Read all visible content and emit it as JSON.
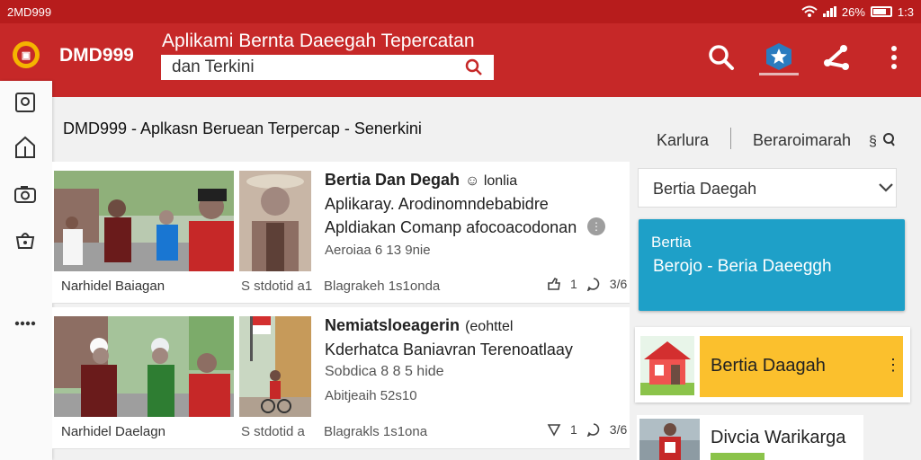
{
  "status": {
    "left": "2MD999",
    "battery": "26%",
    "time": "1:3"
  },
  "appbar": {
    "brand": "DMD999",
    "headline": "Aplikami Bernta Daeegah Tepercatan",
    "search_value": "dan Terkini",
    "actions": [
      "search-icon",
      "star-icon",
      "share-icon",
      "more-vert-icon"
    ]
  },
  "sidenav": {
    "items": [
      "profile-icon",
      "home-icon",
      "camera-icon",
      "basket-icon",
      "more-horiz-icon"
    ]
  },
  "page_title": "DMD999 - Aplkasn Beruean Terpercap - Senerkini",
  "feed": [
    {
      "title": "Bertia Dan Degah",
      "title_sub": "☺ lonlia",
      "desc1": "Aplikaray. Arodinomndebabidre",
      "desc2": "Apldiakan Comanp afocoacodonan",
      "meta": "Aeroiaa 6 13 9nie",
      "foot_left": "Narhidel Baiagan",
      "foot_mid": "S stdotid a1",
      "foot_right": "Blagrakeh 1s1onda",
      "count1": "1",
      "count2": "3/6"
    },
    {
      "title": "Nemiatsloeagerin",
      "title_sub": "(eohttel",
      "desc1": "Kderhatca Baniavran Terenoatlaay",
      "desc2": "Sobdica 8 8 5 hide",
      "meta": "Abitjeaih 52s10",
      "foot_left": "Narhidel Daelagn",
      "foot_mid": "S stdotid a",
      "foot_right": "Blagrakls 1s1ona",
      "count1": "1",
      "count2": "3/6"
    }
  ],
  "tabs": {
    "left": "Karlura",
    "right": "Beraroimarah"
  },
  "dropdown_label": "Bertia Daegah",
  "blue_card": {
    "line1": "Bertia",
    "line2": "Berojo - Beria Daeeggh"
  },
  "promo_label": "Bertia Daagah",
  "news2_label": "Divcia Warikarga",
  "colors": {
    "primary": "#c62828",
    "status": "#b71c1c",
    "blue_card": "#1ea0c8",
    "promo": "#fbc02d"
  }
}
